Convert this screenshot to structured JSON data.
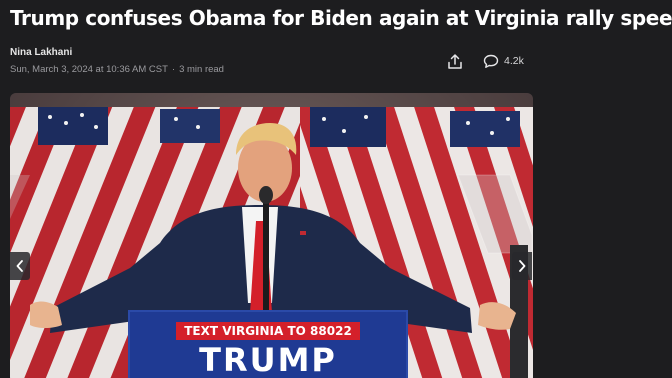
{
  "article": {
    "headline": "Trump confuses Obama for Biden again at Virginia rally speech",
    "author": "Nina Lakhani",
    "timestamp": "Sun, March 3, 2024 at 10:36 AM CST",
    "read_time": "3 min read",
    "separator": "·"
  },
  "actions": {
    "share_icon": "share-icon",
    "comment_icon": "comment-icon",
    "comment_count": "4.2k"
  },
  "photo": {
    "sign_line1": "TEXT VIRGINIA TO 88022",
    "sign_line2": "TRUMP",
    "prev_icon": "chevron-left-icon",
    "next_icon": "chevron-right-icon"
  },
  "colors": {
    "background": "#1d1d1f",
    "flag_red": "#b8262e",
    "flag_blue": "#1c2c5e",
    "sign_blue": "#1f3a93",
    "sign_red": "#d4202a"
  }
}
